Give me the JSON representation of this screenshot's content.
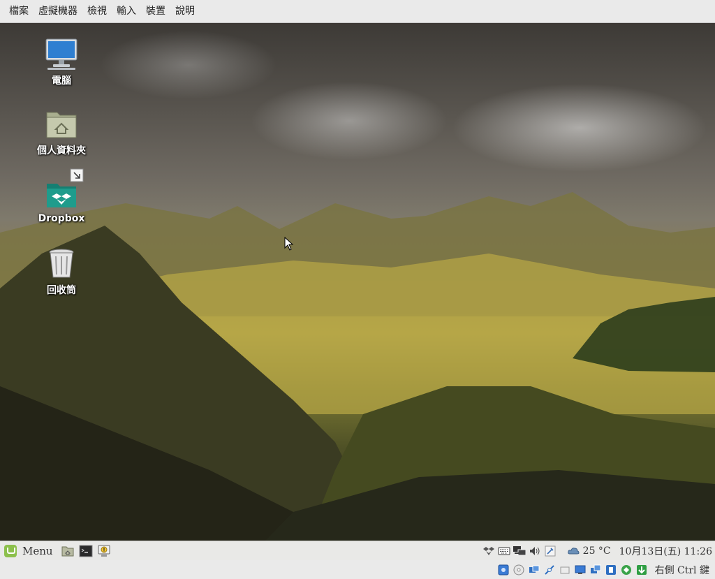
{
  "vm_menubar": {
    "items": [
      "檔案",
      "虛擬機器",
      "檢視",
      "輸入",
      "裝置",
      "說明"
    ]
  },
  "desktop": {
    "icons": [
      {
        "name": "computer",
        "label": "電腦",
        "icon": "monitor-icon"
      },
      {
        "name": "home-folder",
        "label": "個人資料夾",
        "icon": "home-folder-icon"
      },
      {
        "name": "dropbox",
        "label": "Dropbox",
        "icon": "dropbox-folder-icon"
      },
      {
        "name": "trash",
        "label": "回收筒",
        "icon": "trash-icon"
      }
    ]
  },
  "panel": {
    "menu_label": "Menu",
    "launchers": [
      "files-icon",
      "terminal-icon",
      "update-manager-icon"
    ],
    "tray_icons": [
      "dropbox-tray-icon",
      "keyboard-icon",
      "network-icon",
      "volume-icon",
      "power-icon"
    ],
    "weather": "25 °C",
    "clock": "10月13日(五) 11:26"
  },
  "vm_statusbar": {
    "icons": [
      "hard-disk-icon",
      "optical-disk-icon",
      "audio-icon",
      "network-adapter-icon",
      "usb-icon",
      "shared-folder-icon",
      "display-icon",
      "recording-icon",
      "cpu-icon",
      "mouse-integration-icon",
      "arrow-down-icon"
    ],
    "host_key": "右側 Ctrl 鍵"
  },
  "colors": {
    "panel_bg": "#e9e9e7",
    "mint_green": "#8cc04b",
    "dropbox_teal": "#1e9c8c"
  }
}
